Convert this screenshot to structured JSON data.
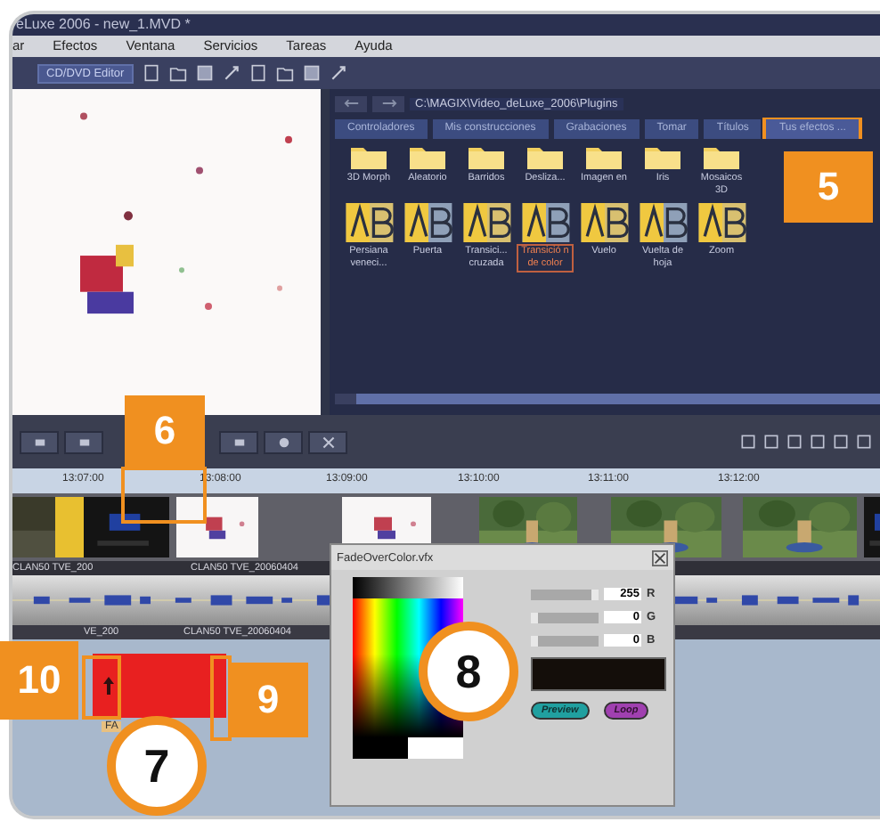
{
  "window": {
    "title": "eLuxe 2006 - new_1.MVD *"
  },
  "menu": [
    "ar",
    "Efectos",
    "Ventana",
    "Servicios",
    "Tareas",
    "Ayuda"
  ],
  "toolbar": {
    "mode_button": "CD/DVD Editor"
  },
  "preview": {
    "kind": "picture"
  },
  "browser": {
    "path": "C:\\MAGIX\\Video_deLuxe_2006\\Plugins",
    "tabs": [
      {
        "label": "Controladores",
        "selected": false
      },
      {
        "label": "Mis construcciones",
        "selected": false
      },
      {
        "label": "Grabaciones",
        "selected": false
      },
      {
        "label": "Tomar",
        "selected": false
      },
      {
        "label": "Títulos",
        "selected": false
      },
      {
        "label": "Tus efectos ...",
        "selected": true
      }
    ],
    "folders": [
      "3D Morph",
      "Aleatorio",
      "Barridos",
      "Desliza...",
      "Imagen en",
      "Iris",
      "Mosaicos 3D"
    ],
    "effects": [
      {
        "label": "Persiana veneci...",
        "selected": false
      },
      {
        "label": "Puerta",
        "selected": false
      },
      {
        "label": "Transici... cruzada",
        "selected": false
      },
      {
        "label": "Transició n de color",
        "selected": true
      },
      {
        "label": "Vuelo",
        "selected": false
      },
      {
        "label": "Vuelta de hoja",
        "selected": false
      },
      {
        "label": "Zoom",
        "selected": false
      }
    ]
  },
  "timeline": {
    "ruler": [
      "13:07:00",
      "13:08:00",
      "13:09:00",
      "13:10:00",
      "13:11:00",
      "13:12:00"
    ],
    "clip_labels": [
      "CLAN50 TVE_200",
      "CLAN50 TVE_20060404",
      "VE_200",
      "CLAN50 TVE_20060404"
    ],
    "effect_clip": {
      "label": "FA"
    }
  },
  "dialog": {
    "title": "FadeOverColor.vfx",
    "channels": [
      {
        "value": "255",
        "name": "R",
        "level": 1
      },
      {
        "value": "0",
        "name": "G",
        "level": 0
      },
      {
        "value": "0",
        "name": "B",
        "level": 0
      }
    ],
    "buttons": [
      "Preview",
      "Loop"
    ]
  },
  "callouts": [
    {
      "number": "5",
      "kind": "square"
    },
    {
      "number": "6",
      "kind": "square"
    },
    {
      "number": "10",
      "kind": "square"
    },
    {
      "number": "9",
      "kind": "square"
    },
    {
      "number": "7",
      "kind": "circle"
    },
    {
      "number": "8",
      "kind": "circle"
    }
  ]
}
